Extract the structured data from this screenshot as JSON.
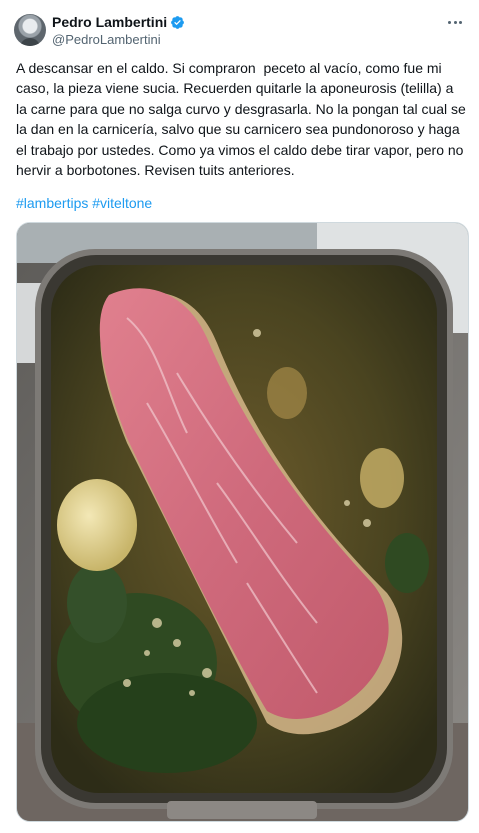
{
  "author": {
    "name": "Pedro Lambertini",
    "handle": "@PedroLambertini",
    "verified": true
  },
  "tweet": {
    "text": "A descansar en el caldo. Si compraron  peceto al vacío, como fue mi caso, la pieza viene sucia. Recuerden quitarle la aponeurosis (telilla) a la carne para que no salga curvo y desgrasarla. No la pongan tal cual se la dan en la carnicería, salvo que su carnicero sea pundonoroso y haga el trabajo por ustedes. Como ya vimos el caldo debe tirar vapor, pero no hervir a borbotones. Revisen tuits anteriores.",
    "hashtags": [
      "#lambertips",
      "#viteltone"
    ]
  },
  "icons": {
    "more": "more-horizontal-icon",
    "verified": "verified-badge-icon"
  },
  "colors": {
    "accent": "#1d9bf0",
    "text_secondary": "#536471"
  }
}
